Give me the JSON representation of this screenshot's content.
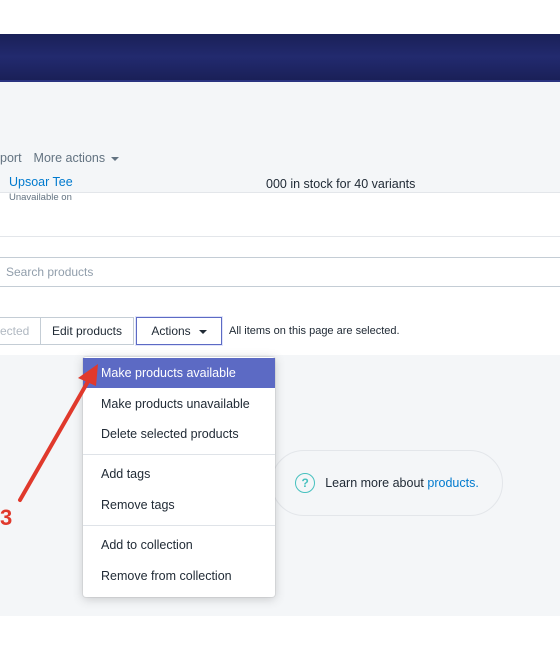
{
  "header": {
    "import_label": "port",
    "more_actions_label": "More actions"
  },
  "search": {
    "placeholder": "Search products"
  },
  "bulk": {
    "selected_label": "ected",
    "edit_label": "Edit products",
    "actions_label": "Actions",
    "note": "All items on this page are selected."
  },
  "product": {
    "name": "Upsoar Tee",
    "status": "Unavailable on",
    "stock": "000 in stock for 40 variants"
  },
  "menu": {
    "items": [
      "Make products available",
      "Make products unavailable",
      "Delete selected products",
      "Add tags",
      "Remove tags",
      "Add to collection",
      "Remove from collection"
    ]
  },
  "learn": {
    "text": "Learn more about",
    "link": "products."
  },
  "annotation": {
    "step": "3"
  },
  "colors": {
    "topbar": "#1c2260",
    "accent": "#5c6ac4",
    "link": "#007ace",
    "annotation": "#e0392c"
  }
}
